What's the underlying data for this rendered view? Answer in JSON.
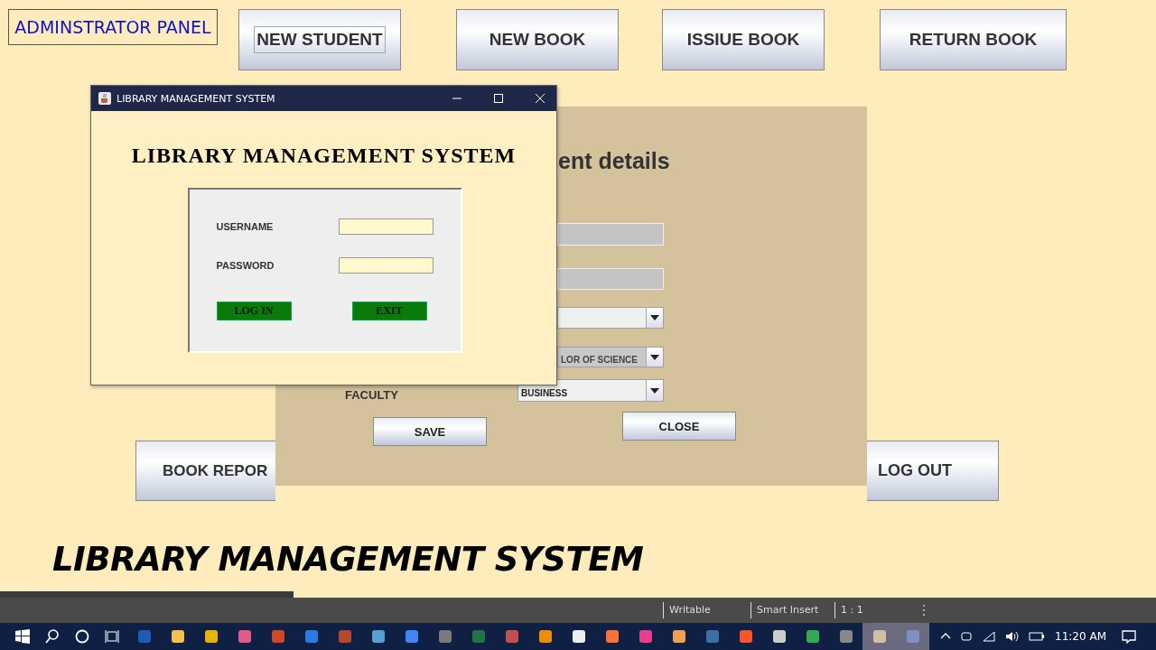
{
  "admin_panel": {
    "title_label": "ADMINSTRATOR PANEL",
    "top_buttons": [
      {
        "label": "NEW STUDENT",
        "focused": true
      },
      {
        "label": "NEW BOOK",
        "focused": false
      },
      {
        "label": "ISSIUE BOOK",
        "focused": false
      },
      {
        "label": "RETURN BOOK",
        "focused": false
      }
    ],
    "bottom_buttons": [
      "BOOK REPOR",
      "LOG OUT"
    ],
    "banner": "LIBRARY MANAGEMENT SYSTEM"
  },
  "student_details": {
    "title": "ent details",
    "fields": [
      {
        "kind": "text",
        "disabled": true
      },
      {
        "kind": "text",
        "disabled": true
      },
      {
        "kind": "combo",
        "disabled": false
      },
      {
        "kind": "combo",
        "disabled": true,
        "value": "LOR OF SCIENCE"
      },
      {
        "kind": "combo",
        "disabled": false,
        "label": "FACULTY",
        "value": "BUSINESS"
      }
    ],
    "buttons": [
      "SAVE",
      "CLOSE"
    ]
  },
  "login_window": {
    "title": "LIBRARY MANAGEMENT SYSTEM",
    "heading": "LIBRARY MANAGEMENT SYSTEM",
    "fields": [
      {
        "label": "USERNAME"
      },
      {
        "label": "PASSWORD"
      }
    ],
    "buttons": [
      "LOG IN",
      "EXIT"
    ]
  },
  "editor_status_bar": [
    "Writable",
    "Smart Insert",
    "1 : 1"
  ],
  "taskbar": {
    "clock": "11:20 AM"
  }
}
